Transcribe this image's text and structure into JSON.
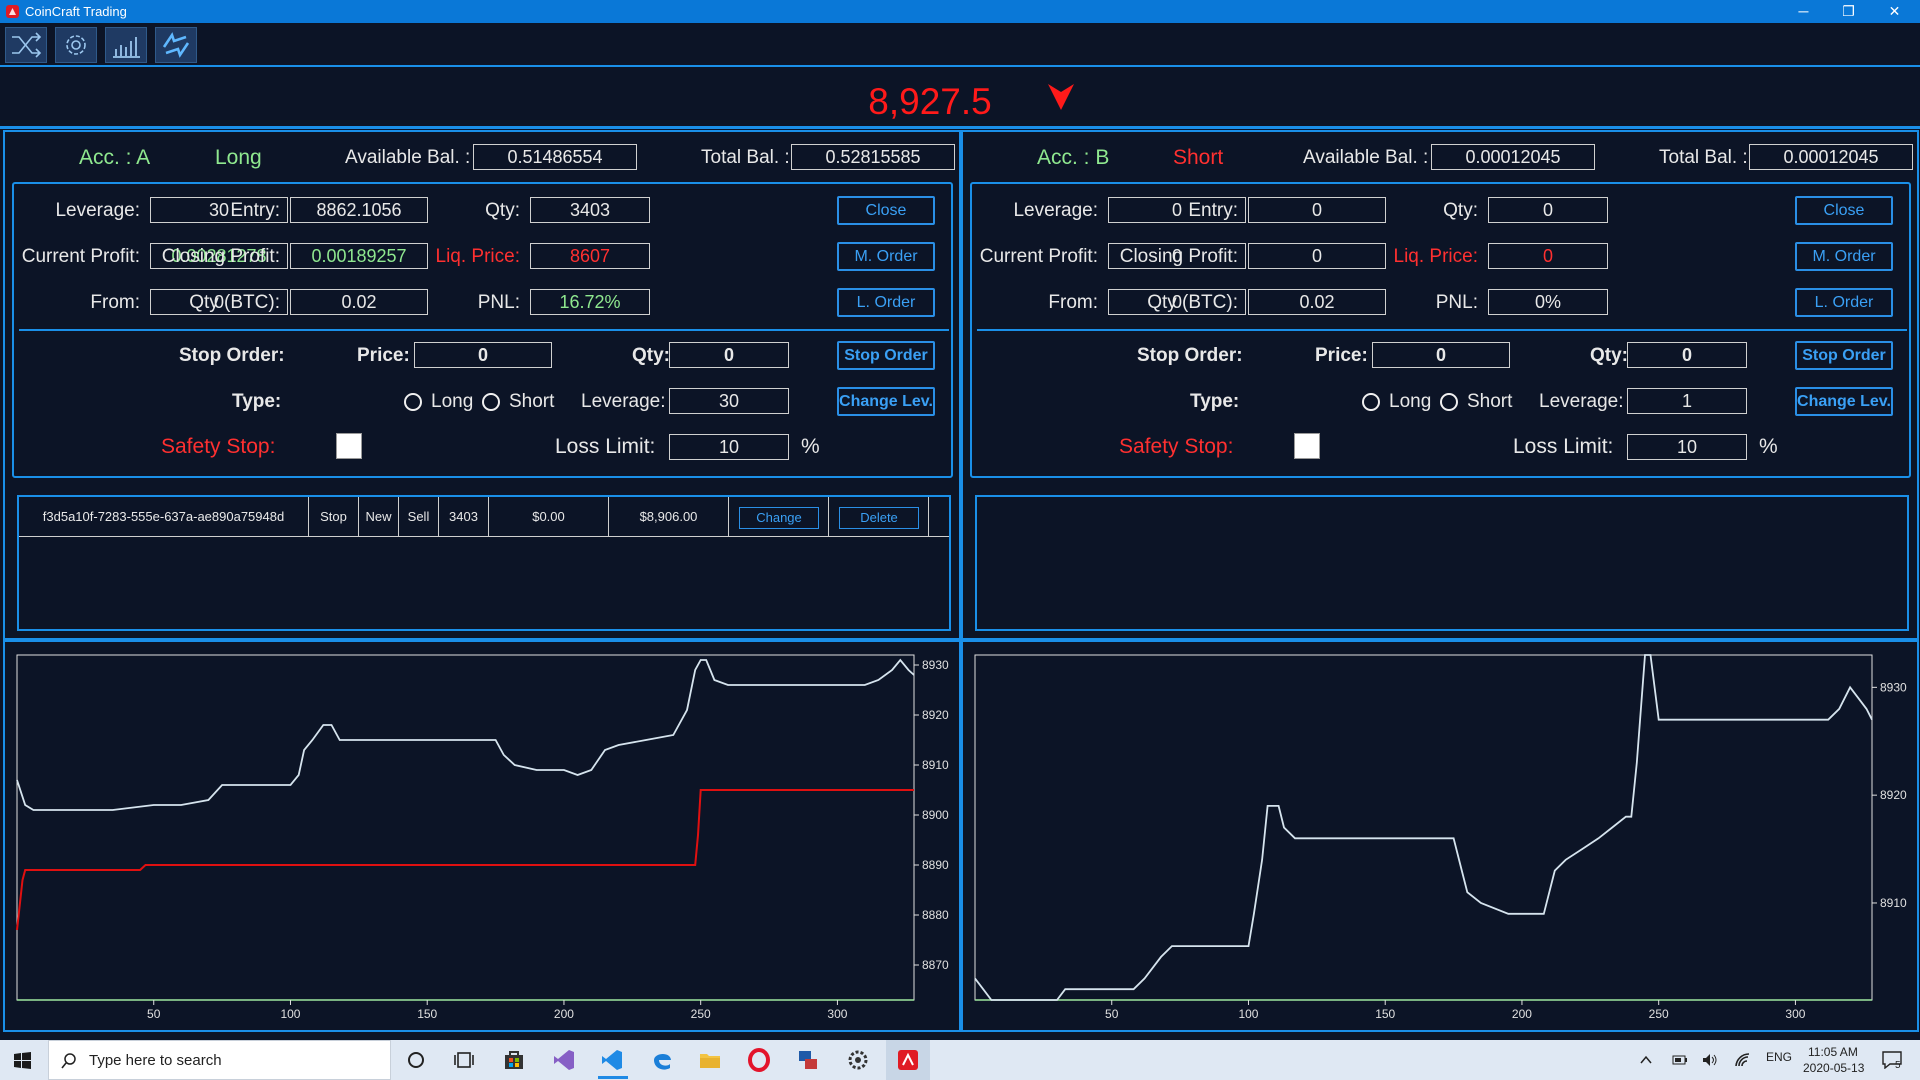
{
  "window": {
    "title": "CoinCraft Trading",
    "minimize": "─",
    "maximize": "❐",
    "close": "✕"
  },
  "toolbar": {
    "buttons": [
      "shuffle-icon",
      "settings-icon",
      "chart-icon",
      "sync-icon"
    ]
  },
  "ticker": {
    "price": "8,927.5",
    "direction": "down",
    "color": "#ff1a1a"
  },
  "accounts": [
    {
      "name": "Acc. : A",
      "side": "Long",
      "side_color": "#8fe88f",
      "available_label": "Available Bal. :",
      "available": "0.51486554",
      "total_label": "Total Bal. :",
      "total": "0.52815585",
      "leverage_label": "Leverage:",
      "leverage": "30",
      "entry_label": "Entry:",
      "entry": "8862.1056",
      "qty_label": "Qty:",
      "qty": "3403",
      "current_profit_label": "Current Profit:",
      "current_profit": "0.00281278",
      "closing_profit_label": "Closing Profit:",
      "closing_profit": "0.00189257",
      "liq_label": "Liq. Price:",
      "liq_price": "8607",
      "from_label": "From:",
      "from": "0",
      "qty_btc_label": "Qty (BTC):",
      "qty_btc": "0.02",
      "pnl_label": "PNL:",
      "pnl": "16.72%",
      "close_btn": "Close",
      "m_order_btn": "M. Order",
      "l_order_btn": "L. Order",
      "stop_order_label": "Stop Order:",
      "price_label": "Price:",
      "stop_price": "0",
      "stop_qty_label": "Qty:",
      "stop_qty": "0",
      "stop_order_btn": "Stop Order",
      "type_label": "Type:",
      "long_label": "Long",
      "short_label": "Short",
      "type_selected": "none",
      "stop_leverage_label": "Leverage:",
      "stop_leverage": "30",
      "change_lev_btn": "Change Lev.",
      "safety_stop_label": "Safety Stop:",
      "safety_checked": false,
      "loss_limit_label": "Loss Limit:",
      "loss_limit": "10",
      "percent": "%",
      "orders": [
        {
          "id": "f3d5a10f-7283-555e-637a-ae890a75948d",
          "type": "Stop",
          "status": "New",
          "side": "Sell",
          "qty": "3403",
          "amount": "$0.00",
          "price": "$8,906.00",
          "change": "Change",
          "delete": "Delete"
        }
      ]
    },
    {
      "name": "Acc. : B",
      "side": "Short",
      "side_color": "#ff3030",
      "available_label": "Available Bal. :",
      "available": "0.00012045",
      "total_label": "Total Bal. :",
      "total": "0.00012045",
      "leverage_label": "Leverage:",
      "leverage": "0",
      "entry_label": "Entry:",
      "entry": "0",
      "qty_label": "Qty:",
      "qty": "0",
      "current_profit_label": "Current Profit:",
      "current_profit": "0",
      "closing_profit_label": "Closing Profit:",
      "closing_profit": "0",
      "liq_label": "Liq. Price:",
      "liq_price": "0",
      "from_label": "From:",
      "from": "0",
      "qty_btc_label": "Qty (BTC):",
      "qty_btc": "0.02",
      "pnl_label": "PNL:",
      "pnl": "0%",
      "close_btn": "Close",
      "m_order_btn": "M. Order",
      "l_order_btn": "L. Order",
      "stop_order_label": "Stop Order:",
      "price_label": "Price:",
      "stop_price": "0",
      "stop_qty_label": "Qty:",
      "stop_qty": "0",
      "stop_order_btn": "Stop Order",
      "type_label": "Type:",
      "long_label": "Long",
      "short_label": "Short",
      "type_selected": "none",
      "stop_leverage_label": "Leverage:",
      "stop_leverage": "1",
      "change_lev_btn": "Change Lev.",
      "safety_stop_label": "Safety Stop:",
      "safety_checked": false,
      "loss_limit_label": "Loss Limit:",
      "loss_limit": "10",
      "percent": "%",
      "orders": []
    }
  ],
  "chart_data": [
    {
      "type": "line",
      "xlim": [
        0,
        328
      ],
      "ylim": [
        8863,
        8932
      ],
      "xticks": [
        50,
        100,
        150,
        200,
        250,
        300
      ],
      "yticks": [
        8870,
        8880,
        8890,
        8900,
        8910,
        8920,
        8930
      ],
      "series": [
        {
          "color": "#d6e4ee",
          "points": [
            [
              0,
              8907
            ],
            [
              3,
              8902
            ],
            [
              6,
              8901
            ],
            [
              15,
              8901
            ],
            [
              25,
              8901
            ],
            [
              35,
              8901
            ],
            [
              50,
              8902
            ],
            [
              60,
              8902
            ],
            [
              70,
              8903
            ],
            [
              75,
              8906
            ],
            [
              85,
              8906
            ],
            [
              100,
              8906
            ],
            [
              103,
              8908
            ],
            [
              105,
              8913
            ],
            [
              108,
              8915
            ],
            [
              112,
              8918
            ],
            [
              115,
              8918
            ],
            [
              118,
              8915
            ],
            [
              125,
              8915
            ],
            [
              140,
              8915
            ],
            [
              160,
              8915
            ],
            [
              175,
              8915
            ],
            [
              178,
              8912
            ],
            [
              182,
              8910
            ],
            [
              190,
              8909
            ],
            [
              200,
              8909
            ],
            [
              205,
              8908
            ],
            [
              210,
              8909
            ],
            [
              215,
              8913
            ],
            [
              220,
              8914
            ],
            [
              230,
              8915
            ],
            [
              240,
              8916
            ],
            [
              245,
              8921
            ],
            [
              248,
              8929
            ],
            [
              250,
              8931
            ],
            [
              252,
              8931
            ],
            [
              255,
              8927
            ],
            [
              260,
              8926
            ],
            [
              270,
              8926
            ],
            [
              280,
              8926
            ],
            [
              295,
              8926
            ],
            [
              310,
              8926
            ],
            [
              315,
              8927
            ],
            [
              320,
              8929
            ],
            [
              323,
              8931
            ],
            [
              326,
              8929
            ],
            [
              328,
              8928
            ]
          ]
        },
        {
          "color": "#e01010",
          "points": [
            [
              0,
              8877
            ],
            [
              2,
              8887
            ],
            [
              3,
              8889
            ],
            [
              10,
              8889
            ],
            [
              30,
              8889
            ],
            [
              45,
              8889
            ],
            [
              47,
              8890
            ],
            [
              100,
              8890
            ],
            [
              150,
              8890
            ],
            [
              200,
              8890
            ],
            [
              240,
              8890
            ],
            [
              248,
              8890
            ],
            [
              249,
              8896
            ],
            [
              250,
              8905
            ],
            [
              255,
              8905
            ],
            [
              290,
              8905
            ],
            [
              328,
              8905
            ]
          ]
        }
      ]
    },
    {
      "type": "line",
      "xlim": [
        0,
        328
      ],
      "ylim": [
        8901,
        8933
      ],
      "xticks": [
        50,
        100,
        150,
        200,
        250,
        300
      ],
      "yticks": [
        8910,
        8920,
        8930
      ],
      "series": [
        {
          "color": "#d6e4ee",
          "points": [
            [
              0,
              8903
            ],
            [
              3,
              8902
            ],
            [
              6,
              8901
            ],
            [
              10,
              8901
            ],
            [
              20,
              8901
            ],
            [
              25,
              8901
            ],
            [
              30,
              8901
            ],
            [
              33,
              8902
            ],
            [
              40,
              8902
            ],
            [
              45,
              8902
            ],
            [
              50,
              8902
            ],
            [
              58,
              8902
            ],
            [
              62,
              8903
            ],
            [
              68,
              8905
            ],
            [
              72,
              8906
            ],
            [
              80,
              8906
            ],
            [
              90,
              8906
            ],
            [
              100,
              8906
            ],
            [
              102,
              8909
            ],
            [
              105,
              8914
            ],
            [
              107,
              8919
            ],
            [
              111,
              8919
            ],
            [
              113,
              8917
            ],
            [
              117,
              8916
            ],
            [
              125,
              8916
            ],
            [
              140,
              8916
            ],
            [
              160,
              8916
            ],
            [
              175,
              8916
            ],
            [
              178,
              8913
            ],
            [
              180,
              8911
            ],
            [
              185,
              8910
            ],
            [
              195,
              8909
            ],
            [
              200,
              8909
            ],
            [
              208,
              8909
            ],
            [
              210,
              8911
            ],
            [
              212,
              8913
            ],
            [
              216,
              8914
            ],
            [
              222,
              8915
            ],
            [
              228,
              8916
            ],
            [
              233,
              8917
            ],
            [
              238,
              8918
            ],
            [
              240,
              8918
            ],
            [
              242,
              8923
            ],
            [
              245,
              8933
            ],
            [
              247,
              8933
            ],
            [
              250,
              8927
            ],
            [
              255,
              8927
            ],
            [
              265,
              8927
            ],
            [
              280,
              8927
            ],
            [
              300,
              8927
            ],
            [
              312,
              8927
            ],
            [
              316,
              8928
            ],
            [
              320,
              8930
            ],
            [
              323,
              8929
            ],
            [
              326,
              8928
            ],
            [
              328,
              8927
            ]
          ]
        }
      ]
    }
  ],
  "taskbar": {
    "search_placeholder": "Type here to search",
    "lang": "ENG",
    "time": "11:05 AM",
    "date": "2020-05-13",
    "notifications": "5"
  }
}
